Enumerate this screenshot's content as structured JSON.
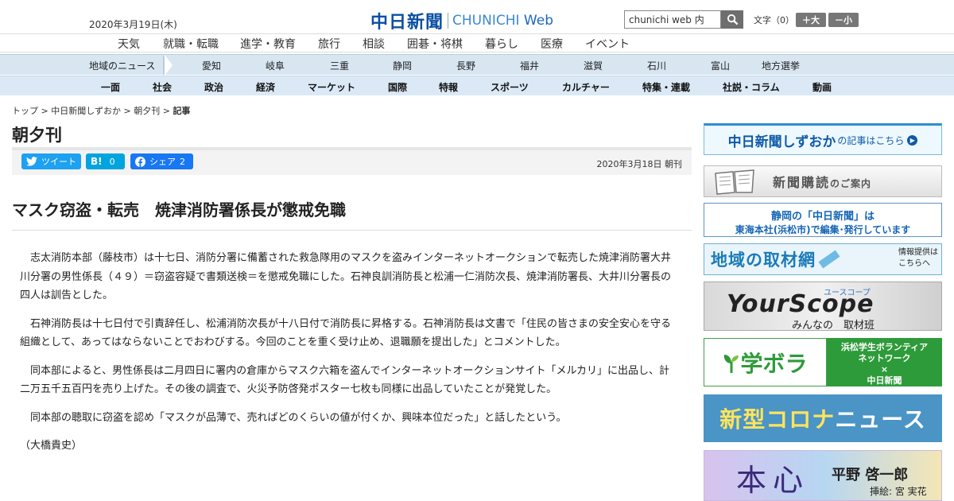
{
  "header": {
    "date": "2020年3月19日(木)",
    "logo_jp": "中日新聞",
    "logo_en": "CHUNICHI",
    "logo_web": "Web",
    "search_value": "chunichi web 内",
    "fontsize_label": "文字（0）",
    "font_up": "＋大",
    "font_down": "－小"
  },
  "nav_primary": [
    "天気",
    "就職・転職",
    "進学・教育",
    "旅行",
    "相談",
    "囲碁・将棋",
    "暮らし",
    "医療",
    "イベント"
  ],
  "nav_region": {
    "label": "地域のニュース",
    "items": [
      "愛知",
      "岐阜",
      "三重",
      "静岡",
      "長野",
      "福井",
      "滋賀",
      "石川",
      "富山",
      "地方選挙"
    ]
  },
  "nav_categories": [
    "一面",
    "社会",
    "政治",
    "経済",
    "マーケット",
    "国際",
    "特報",
    "スポーツ",
    "カルチャー",
    "特集・連載",
    "社説・コラム",
    "動画"
  ],
  "breadcrumb": {
    "top": "トップ",
    "sep": " > ",
    "site": "中日新聞しずおか",
    "section": "朝夕刊",
    "current": "記事"
  },
  "section_title": "朝夕刊",
  "share": {
    "tweet": "ツイート",
    "hatena_count": "0",
    "fb_label": "シェア",
    "fb_count": "2"
  },
  "article": {
    "published": "2020年3月18日 朝刊",
    "headline": "マスク窃盗・転売　焼津消防署係長が懲戒免職",
    "paragraphs": [
      "志太消防本部（藤枝市）は十七日、消防分署に備蓄された救急隊用のマスクを盗みインターネットオークションで転売した焼津消防署大井川分署の男性係長（４９）＝窃盗容疑で書類送検＝を懲戒免職にした。石神良訓消防長と松浦一仁消防次長、焼津消防署長、大井川分署長の四人は訓告とした。",
      "石神消防長は十七日付で引責辞任し、松浦消防次長が十八日付で消防長に昇格する。石神消防長は文書で「住民の皆さまの安全安心を守る組織として、あってはならないことでおわびする。今回のことを重く受け止め、退職願を提出した」とコメントした。",
      "同本部によると、男性係長は二月四日に署内の倉庫からマスク六箱を盗んでインターネットオークションサイト「メルカリ」に出品し、計二万五千五百円を売り上げた。その後の調査で、火災予防啓発ポスター七枚も同様に出品していたことが発覚した。",
      "同本部の聴取に窃盗を認め「マスクが品薄で、売ればどのくらいの値が付くか、興味本位だった」と話したという。"
    ],
    "byline": "（大橋貴史）"
  },
  "sidebar": {
    "b1_main": "中日新聞しずおか",
    "b1_sub": "の記事はこちら",
    "b2_main": "新聞購読",
    "b2_sub": "のご案内",
    "b3_l1": "静岡の「中日新聞」は",
    "b3_l2": "東海本社(浜松市)で編集･発行しています",
    "b4_main": "地域の取材網",
    "b4_side1": "情報提供は",
    "b4_side2": "こちらへ",
    "b5_main": "YourScope",
    "b5_kana": "ユースコープ",
    "b5_sub": "みんなの　取材班",
    "b6_left": "学ボラ",
    "b6_r1": "浜松学生ボランティア",
    "b6_r2": "ネットワーク",
    "b6_r3": "×",
    "b6_r4": "中日新聞",
    "b7_a": "新型コロナ",
    "b7_b": "ニュース",
    "b8_main": "本心",
    "b8_name": "平野 啓一郎",
    "b8_ill": "挿絵: 宮 実花"
  },
  "colors": {
    "brand": "#0a4fa3",
    "nav_bg": "#d8e6f2",
    "twitter": "#1da1f2",
    "hatena": "#00a4de",
    "facebook": "#1877f2"
  }
}
